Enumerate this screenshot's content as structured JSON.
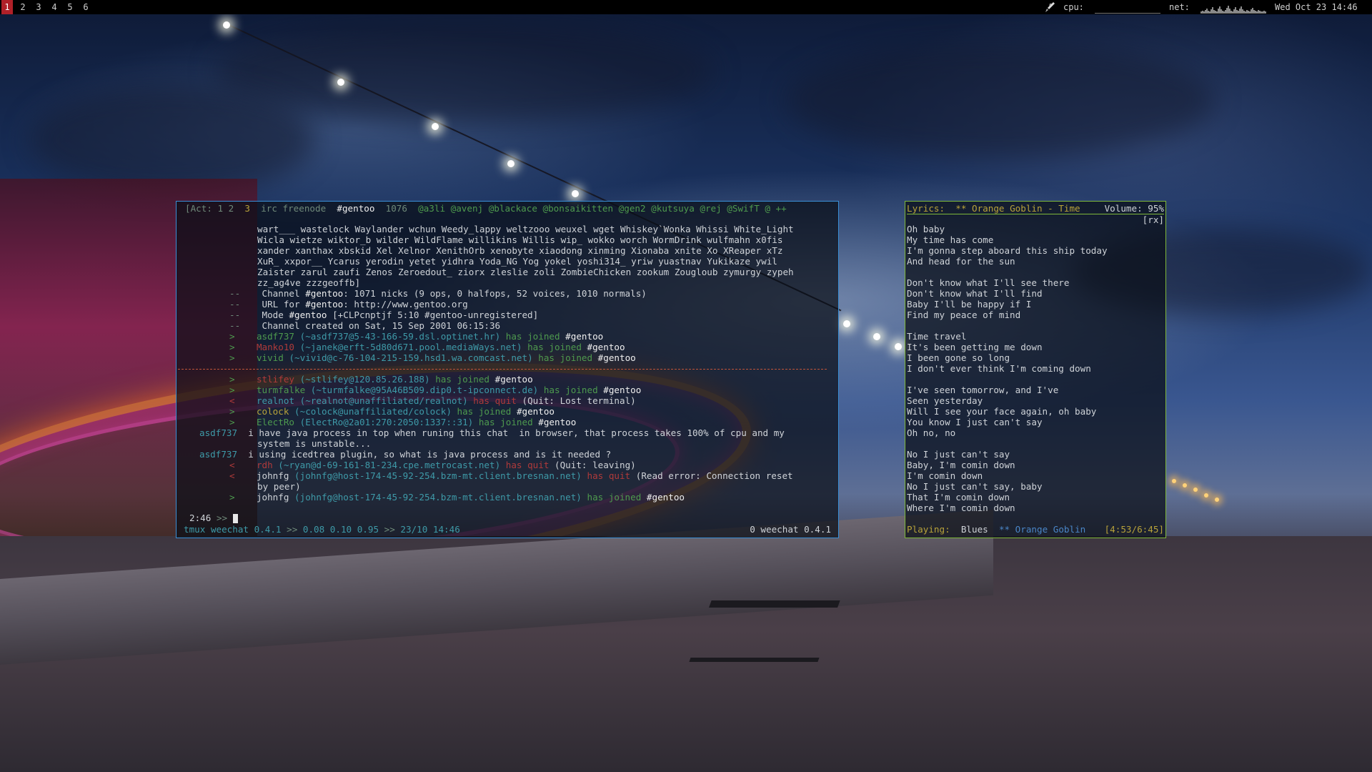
{
  "topbar": {
    "workspaces": [
      "1",
      "2",
      "3",
      "4",
      "5",
      "6"
    ],
    "active_workspace": "1",
    "cpu_label": "cpu:",
    "net_label": "net:",
    "clock": "Wed Oct 23 14:46",
    "icon": "rocket-icon"
  },
  "irc": {
    "title": {
      "act": "[Act: 1 2",
      "act_extra": "3",
      "server": "irc freenode",
      "channel": "#gentoo",
      "count": "1076",
      "ops": "@a3li @avenj @blackace @bonsaikitten @gen2 @kutsuya @rej @SwifT @ ++"
    },
    "nicklist_lines": [
      "wart___ wastelock Waylander wchun Weedy_lappy weltzooo weuxel wget Whiskey`Wonka Whissi White_Light",
      "Wicla wietze wiktor_b wilder WildFlame willikins Willis wip_ wokko worch WormDrink wulfmahn x0fis",
      "xander xanthax xbskid Xel Xelnor XenithOrb xenobyte xiaodong xinming Xionaba xnite Xo XReaper xTz",
      "XuR_ xxpor__ Ycarus yerodin yetet yidhra Yoda_NG Yog yokel yoshi314_ yriw yuastnav Yukikaze ywil",
      "Zaister zarul zaufi Zenos Zeroedout_ ziorx zleslie zoli ZombieChicken zookum Zougloub zymurgy zypeh",
      "zz_ag4ve zzzgeoffb]"
    ],
    "info": [
      {
        "prefix": "--",
        "a": "Channel ",
        "chan": "#gentoo",
        "b": ": 1071 nicks (9 ops, 0 halfops, 52 voices, 1010 normals)"
      },
      {
        "prefix": "--",
        "a": "URL for ",
        "chan": "#gentoo",
        "b": ": http://www.gentoo.org"
      },
      {
        "prefix": "--",
        "a": "Mode ",
        "chan": "#gentoo",
        "b": " [+CLPcnptjf 5:10 #gentoo-unregistered]"
      },
      {
        "prefix": "--",
        "a": "Channel created on Sat, 15 Sep 2001 06:15:36",
        "chan": "",
        "b": ""
      }
    ],
    "joins_before": [
      {
        "nick": "asdf737",
        "host": "(~asdf737@5-43-166-59.dsl.optinet.hr)",
        "action": "has joined",
        "chan": "#gentoo"
      },
      {
        "nick": "Manko10",
        "host": "(~janek@erft-5d80d671.pool.mediaWays.net)",
        "action": "has joined",
        "chan": "#gentoo"
      },
      {
        "nick": "vivid",
        "host": "(~vivid@c-76-104-215-159.hsd1.wa.comcast.net)",
        "action": "has joined",
        "chan": "#gentoo"
      }
    ],
    "events_after": [
      {
        "nick": "stlifey",
        "host": "(~stlifey@120.85.26.188)",
        "action": "has joined",
        "tail": "#gentoo"
      },
      {
        "nick": "turmfalke",
        "host": "(~turmfalke@95A46B509.dip0.t-ipconnect.de)",
        "action": "has joined",
        "tail": "#gentoo"
      },
      {
        "nick": "realnot",
        "host": "(~realnot@unaffiliated/realnot)",
        "action": "has quit",
        "tail": "(Quit: Lost terminal)"
      },
      {
        "nick": "colock",
        "host": "(~colock@unaffiliated/colock)",
        "action": "has joined",
        "tail": "#gentoo"
      },
      {
        "nick": "ElectRo",
        "host": "(ElectRo@2a01:270:2050:1337::31)",
        "action": "has joined",
        "tail": "#gentoo"
      }
    ],
    "msg1": {
      "nick": "asdf737",
      "line1": "i have java process in top when runing this chat  in browser, that process takes 100% of cpu and my",
      "line2": "system is unstable..."
    },
    "msg2": {
      "nick": "asdf737",
      "text": "i using icedtrea plugin, so what is java process and is it needed ?"
    },
    "quit1": {
      "nick": "rdh",
      "host": "(~ryan@d-69-161-81-234.cpe.metrocast.net)",
      "action": "has quit",
      "tail": "(Quit: leaving)"
    },
    "quit2": {
      "nick": "johnfg",
      "host": "(johnfg@host-174-45-92-254.bzm-mt.client.bresnan.net)",
      "action": "has quit",
      "tail": "(Read error: Connection reset",
      "wrap": "by peer)"
    },
    "join_last": {
      "nick": "johnfg",
      "host": "(johnfg@host-174-45-92-254.bzm-mt.client.bresnan.net)",
      "action": "has joined",
      "chan": "#gentoo"
    },
    "input_prompt": "2:46",
    "status": {
      "tmux": "tmux",
      "app": "weechat 0.4.1",
      "load": "0.08 0.10 0.95",
      "date": "23/10 14:46",
      "right": "0 weechat 0.4.1"
    }
  },
  "lyrics": {
    "header": {
      "label": "Lyrics:",
      "song": "** Orange Goblin - Time",
      "volume": "Volume: 95%"
    },
    "tag": "[rx]",
    "lines": [
      "Oh baby",
      "My time has come",
      "I'm gonna step aboard this ship today",
      "And head for the sun",
      "",
      "Don't know what I'll see there",
      "Don't know what I'll find",
      "Baby I'll be happy if I",
      "Find my peace of mind",
      "",
      "Time travel",
      "It's been getting me down",
      "I been gone so long",
      "I don't ever think I'm coming down",
      "",
      "I've seen tomorrow, and I've",
      "Seen yesterday",
      "Will I see your face again, oh baby",
      "You know I just can't say",
      "Oh no, no",
      "",
      "No I just can't say",
      "Baby, I'm comin down",
      "I'm comin down",
      "No I just can't say, baby",
      "That I'm comin down",
      "Where I'm comin down"
    ],
    "status": {
      "playing": "Playing:",
      "song": "Blues",
      "artist": "** Orange Goblin",
      "time": "[4:53/6:45]"
    }
  }
}
